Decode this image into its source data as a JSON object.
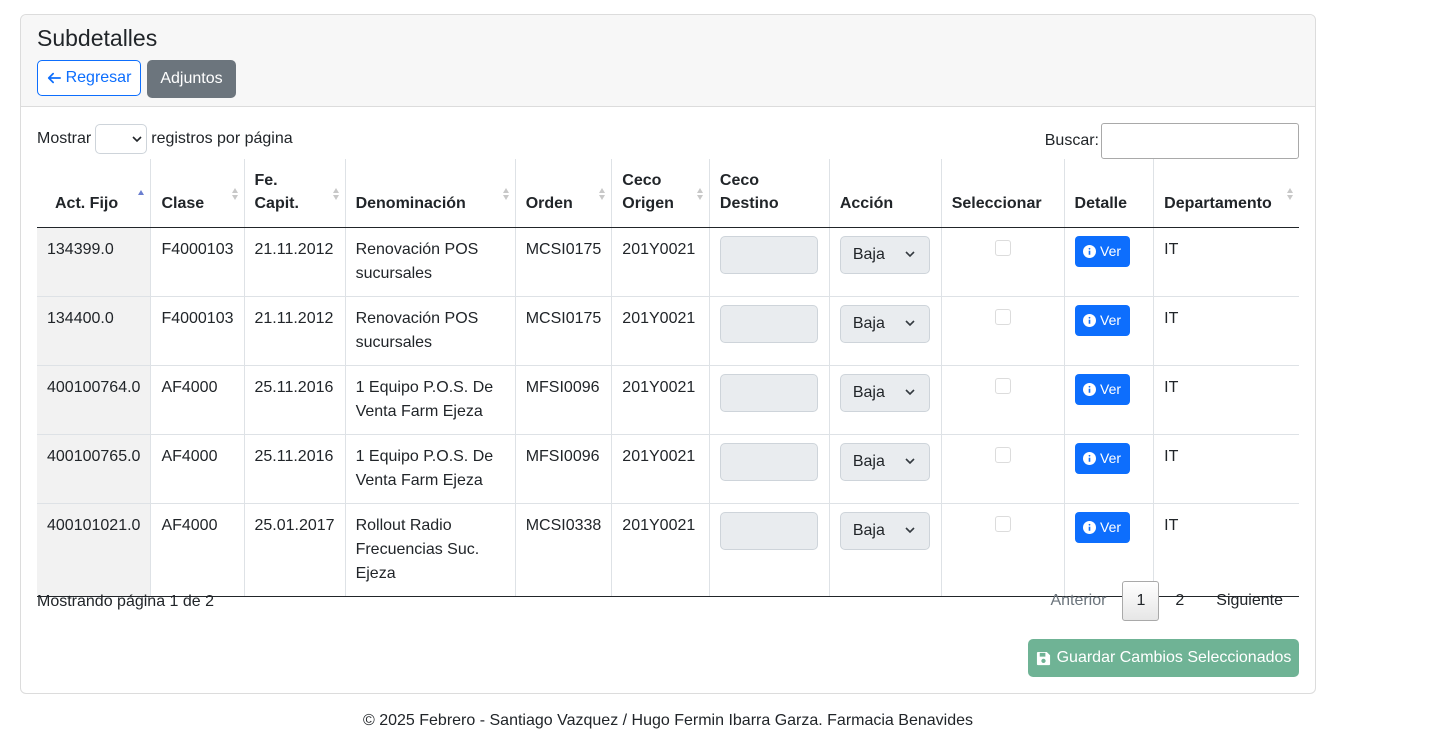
{
  "header": {
    "title": "Subdetalles",
    "back_label": "Regresar",
    "attachments_label": "Adjuntos"
  },
  "controls": {
    "show_label": "Mostrar",
    "per_page_label": "registros por página",
    "search_label": "Buscar:"
  },
  "table": {
    "columns": [
      "Act. Fijo",
      "Clase",
      "Fe. Capit.",
      "Denominación",
      "Orden",
      "Ceco Origen",
      "Ceco Destino",
      "Acción",
      "Seleccionar",
      "Detalle",
      "Departamento"
    ],
    "rows": [
      {
        "act": "134399.0",
        "clase": "F4000103",
        "fecha": "21.11.2012",
        "den": "Renovación POS sucursales",
        "orden": "MCSI0175",
        "ceco": "201Y0021",
        "accion": "Baja",
        "ver": "Ver",
        "depto": "IT"
      },
      {
        "act": "134400.0",
        "clase": "F4000103",
        "fecha": "21.11.2012",
        "den": "Renovación POS sucursales",
        "orden": "MCSI0175",
        "ceco": "201Y0021",
        "accion": "Baja",
        "ver": "Ver",
        "depto": "IT"
      },
      {
        "act": "400100764.0",
        "clase": "AF4000",
        "fecha": "25.11.2016",
        "den": "1 Equipo P.O.S. De Venta Farm Ejeza",
        "orden": "MFSI0096",
        "ceco": "201Y0021",
        "accion": "Baja",
        "ver": "Ver",
        "depto": "IT"
      },
      {
        "act": "400100765.0",
        "clase": "AF4000",
        "fecha": "25.11.2016",
        "den": "1 Equipo P.O.S. De Venta Farm Ejeza",
        "orden": "MFSI0096",
        "ceco": "201Y0021",
        "accion": "Baja",
        "ver": "Ver",
        "depto": "IT"
      },
      {
        "act": "400101021.0",
        "clase": "AF4000",
        "fecha": "25.01.2017",
        "den": "Rollout Radio Frecuencias Suc. Ejeza",
        "orden": "MCSI0338",
        "ceco": "201Y0021",
        "accion": "Baja",
        "ver": "Ver",
        "depto": "IT"
      }
    ]
  },
  "pagination": {
    "info": "Mostrando página 1 de 2",
    "prev": "Anterior",
    "pages": [
      "1",
      "2"
    ],
    "next": "Siguiente",
    "current": "1"
  },
  "save_label": "Guardar Cambios Seleccionados",
  "footer": "© 2025 Febrero - Santiago Vazquez / Hugo Fermin Ibarra Garza. Farmacia Benavides",
  "colors": {
    "primary": "#0d6efd",
    "secondary": "#6c757d",
    "success_disabled": "#6fb395"
  },
  "icons": {
    "back": "arrow-left-icon",
    "info": "info-circle-icon",
    "save": "floppy-disk-icon",
    "sort": "sort-icon",
    "dropdown": "chevron-down-icon"
  }
}
